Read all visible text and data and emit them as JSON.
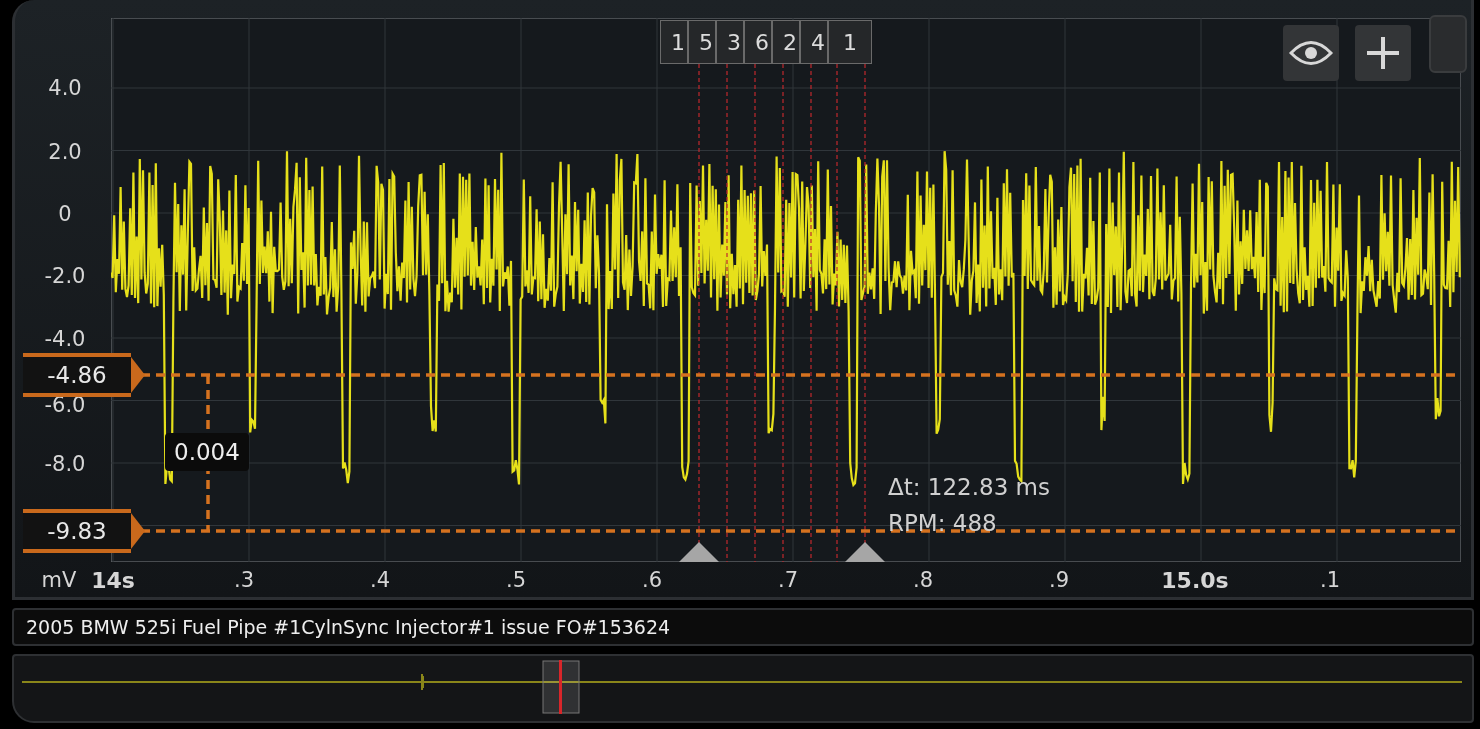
{
  "y_axis": {
    "unit": "mV",
    "ticks": [
      "4.0",
      "2.0",
      "0",
      "-2.0",
      "-4.0",
      "-6.0",
      "-8.0"
    ]
  },
  "x_axis": {
    "labels": [
      {
        "text": "14s",
        "major": true
      },
      {
        "text": ".3",
        "major": false
      },
      {
        "text": ".4",
        "major": false
      },
      {
        "text": ".5",
        "major": false
      },
      {
        "text": ".6",
        "major": false
      },
      {
        "text": ".7",
        "major": false
      },
      {
        "text": ".8",
        "major": false
      },
      {
        "text": ".9",
        "major": false
      },
      {
        "text": "15.0s",
        "major": true
      },
      {
        "text": ".1",
        "major": false
      }
    ]
  },
  "firing_order": [
    "1",
    "5",
    "3",
    "6",
    "2",
    "4",
    "1"
  ],
  "cursors": [
    {
      "value": "-4.86"
    },
    {
      "value": "-9.83"
    }
  ],
  "cursor_delta": "0.004",
  "measurements": [
    "Δt: 122.83 ms",
    "RPM: 488"
  ],
  "recording_title": "2005 BMW 525i Fuel Pipe #1CylnSync Injector#1 issue FO#153624"
}
